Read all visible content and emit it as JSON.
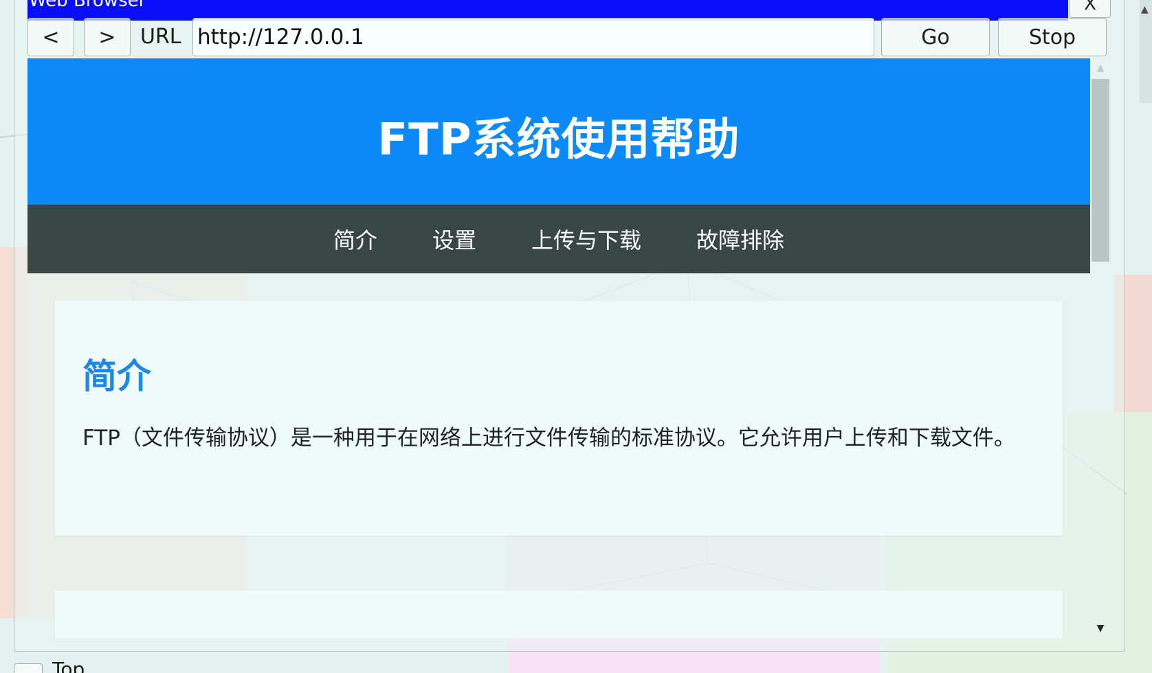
{
  "window": {
    "title": "Web Browser",
    "close_label": "X"
  },
  "toolbar": {
    "back_label": "<",
    "forward_label": ">",
    "url_label": "URL",
    "url_value": "http://127.0.0.1",
    "go_label": "Go",
    "stop_label": "Stop"
  },
  "page": {
    "header_title": "FTP系统使用帮助",
    "nav": [
      {
        "label": "简介"
      },
      {
        "label": "设置"
      },
      {
        "label": "上传与下载"
      },
      {
        "label": "故障排除"
      }
    ],
    "sections": [
      {
        "heading": "简介",
        "body": "FTP（文件传输协议）是一种用于在网络上进行文件传输的标准协议。它允许用户上传和下载文件。"
      }
    ]
  },
  "footer": {
    "top_checkbox_label": "Top"
  },
  "colors": {
    "titlebar": "#0a0df8",
    "page_header": "#0c8af7",
    "page_nav": "#384646",
    "section_heading": "#1e88e5"
  }
}
